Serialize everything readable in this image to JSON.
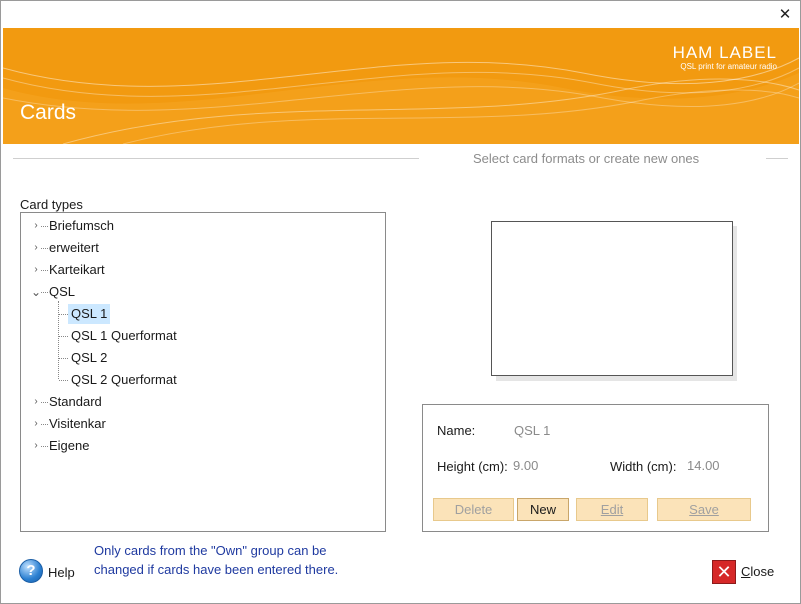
{
  "window": {
    "close_glyph": "✕"
  },
  "banner": {
    "brand": "HAM LABEL",
    "brand_tagline": "QSL print for amateur radio",
    "title": "Cards",
    "color": "#f29a10"
  },
  "subtitle": "Select card formats or create new ones",
  "tree": {
    "label": "Card types",
    "items": [
      {
        "label": "Briefumsch",
        "expanded": false
      },
      {
        "label": "erweitert",
        "expanded": false
      },
      {
        "label": "Karteikart",
        "expanded": false
      },
      {
        "label": "QSL",
        "expanded": true,
        "children": [
          "QSL 1",
          "QSL 1 Querformat",
          "QSL 2",
          "QSL 2 Querformat"
        ],
        "selected_child": "QSL 1"
      },
      {
        "label": "Standard",
        "expanded": false
      },
      {
        "label": "Visitenkar",
        "expanded": false
      },
      {
        "label": "Eigene",
        "expanded": false
      }
    ],
    "chevron_collapsed": "›",
    "chevron_expanded": "⌄"
  },
  "properties": {
    "name_label": "Name:",
    "name_value": "QSL 1",
    "height_label": "Height (cm):",
    "height_value": "9.00",
    "width_label": "Width (cm):",
    "width_value": "14.00",
    "buttons": {
      "delete": "Delete",
      "new": "New",
      "edit": "Edit",
      "save": "Save"
    }
  },
  "help": {
    "icon": "question-icon",
    "label": "Help",
    "glyph": "?"
  },
  "note": "Only cards from the \"Own\" group can be changed if cards have been entered there.",
  "close": {
    "icon": "close-icon",
    "label": "Close",
    "glyph": "✕"
  }
}
